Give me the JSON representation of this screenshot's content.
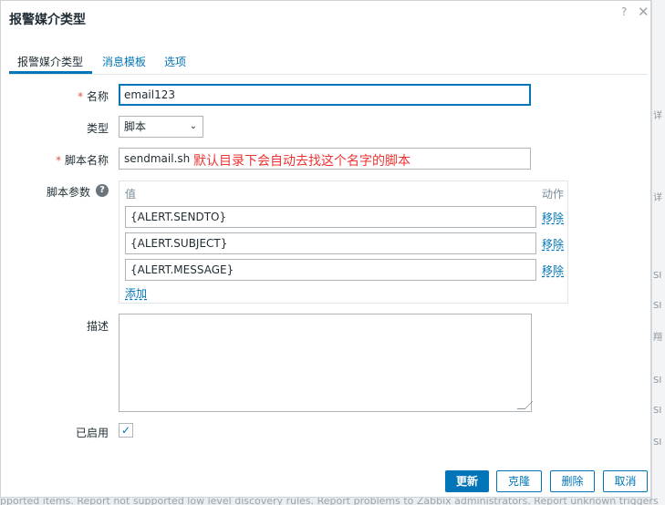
{
  "dialog": {
    "title": "报警媒介类型",
    "help_icon": "question-icon",
    "close_icon": "close-icon"
  },
  "tabs": [
    {
      "label": "报警媒介类型",
      "active": true
    },
    {
      "label": "消息模板",
      "active": false
    },
    {
      "label": "选项",
      "active": false
    }
  ],
  "form": {
    "name_label": "名称",
    "name_value": "email123",
    "type_label": "类型",
    "type_value": "脚本",
    "script_name_label": "脚本名称",
    "script_name_value": "sendmail.sh",
    "script_name_annotation": "默认目录下会自动去找这个名字的脚本",
    "params_label": "脚本参数",
    "params_header_value": "值",
    "params_header_action": "动作",
    "params": [
      {
        "value": "{ALERT.SENDTO}",
        "action": "移除"
      },
      {
        "value": "{ALERT.SUBJECT}",
        "action": "移除"
      },
      {
        "value": "{ALERT.MESSAGE}",
        "action": "移除"
      }
    ],
    "add_label": "添加",
    "description_label": "描述",
    "description_value": "",
    "enabled_label": "已启用",
    "enabled": true
  },
  "buttons": {
    "update": "更新",
    "clone": "克隆",
    "delete": "删除",
    "cancel": "取消"
  },
  "background": {
    "footer_text": "pported items. Report not supported low level discovery rules. Report problems to Zabbix administrators. Report unknown triggers",
    "side_fragments": [
      "详",
      "详",
      "SI",
      "SI",
      "翔",
      "SI",
      "SI",
      "SI"
    ]
  },
  "colors": {
    "accent": "#0275b8",
    "required": "#d9534f",
    "annotation": "#ee3333"
  }
}
